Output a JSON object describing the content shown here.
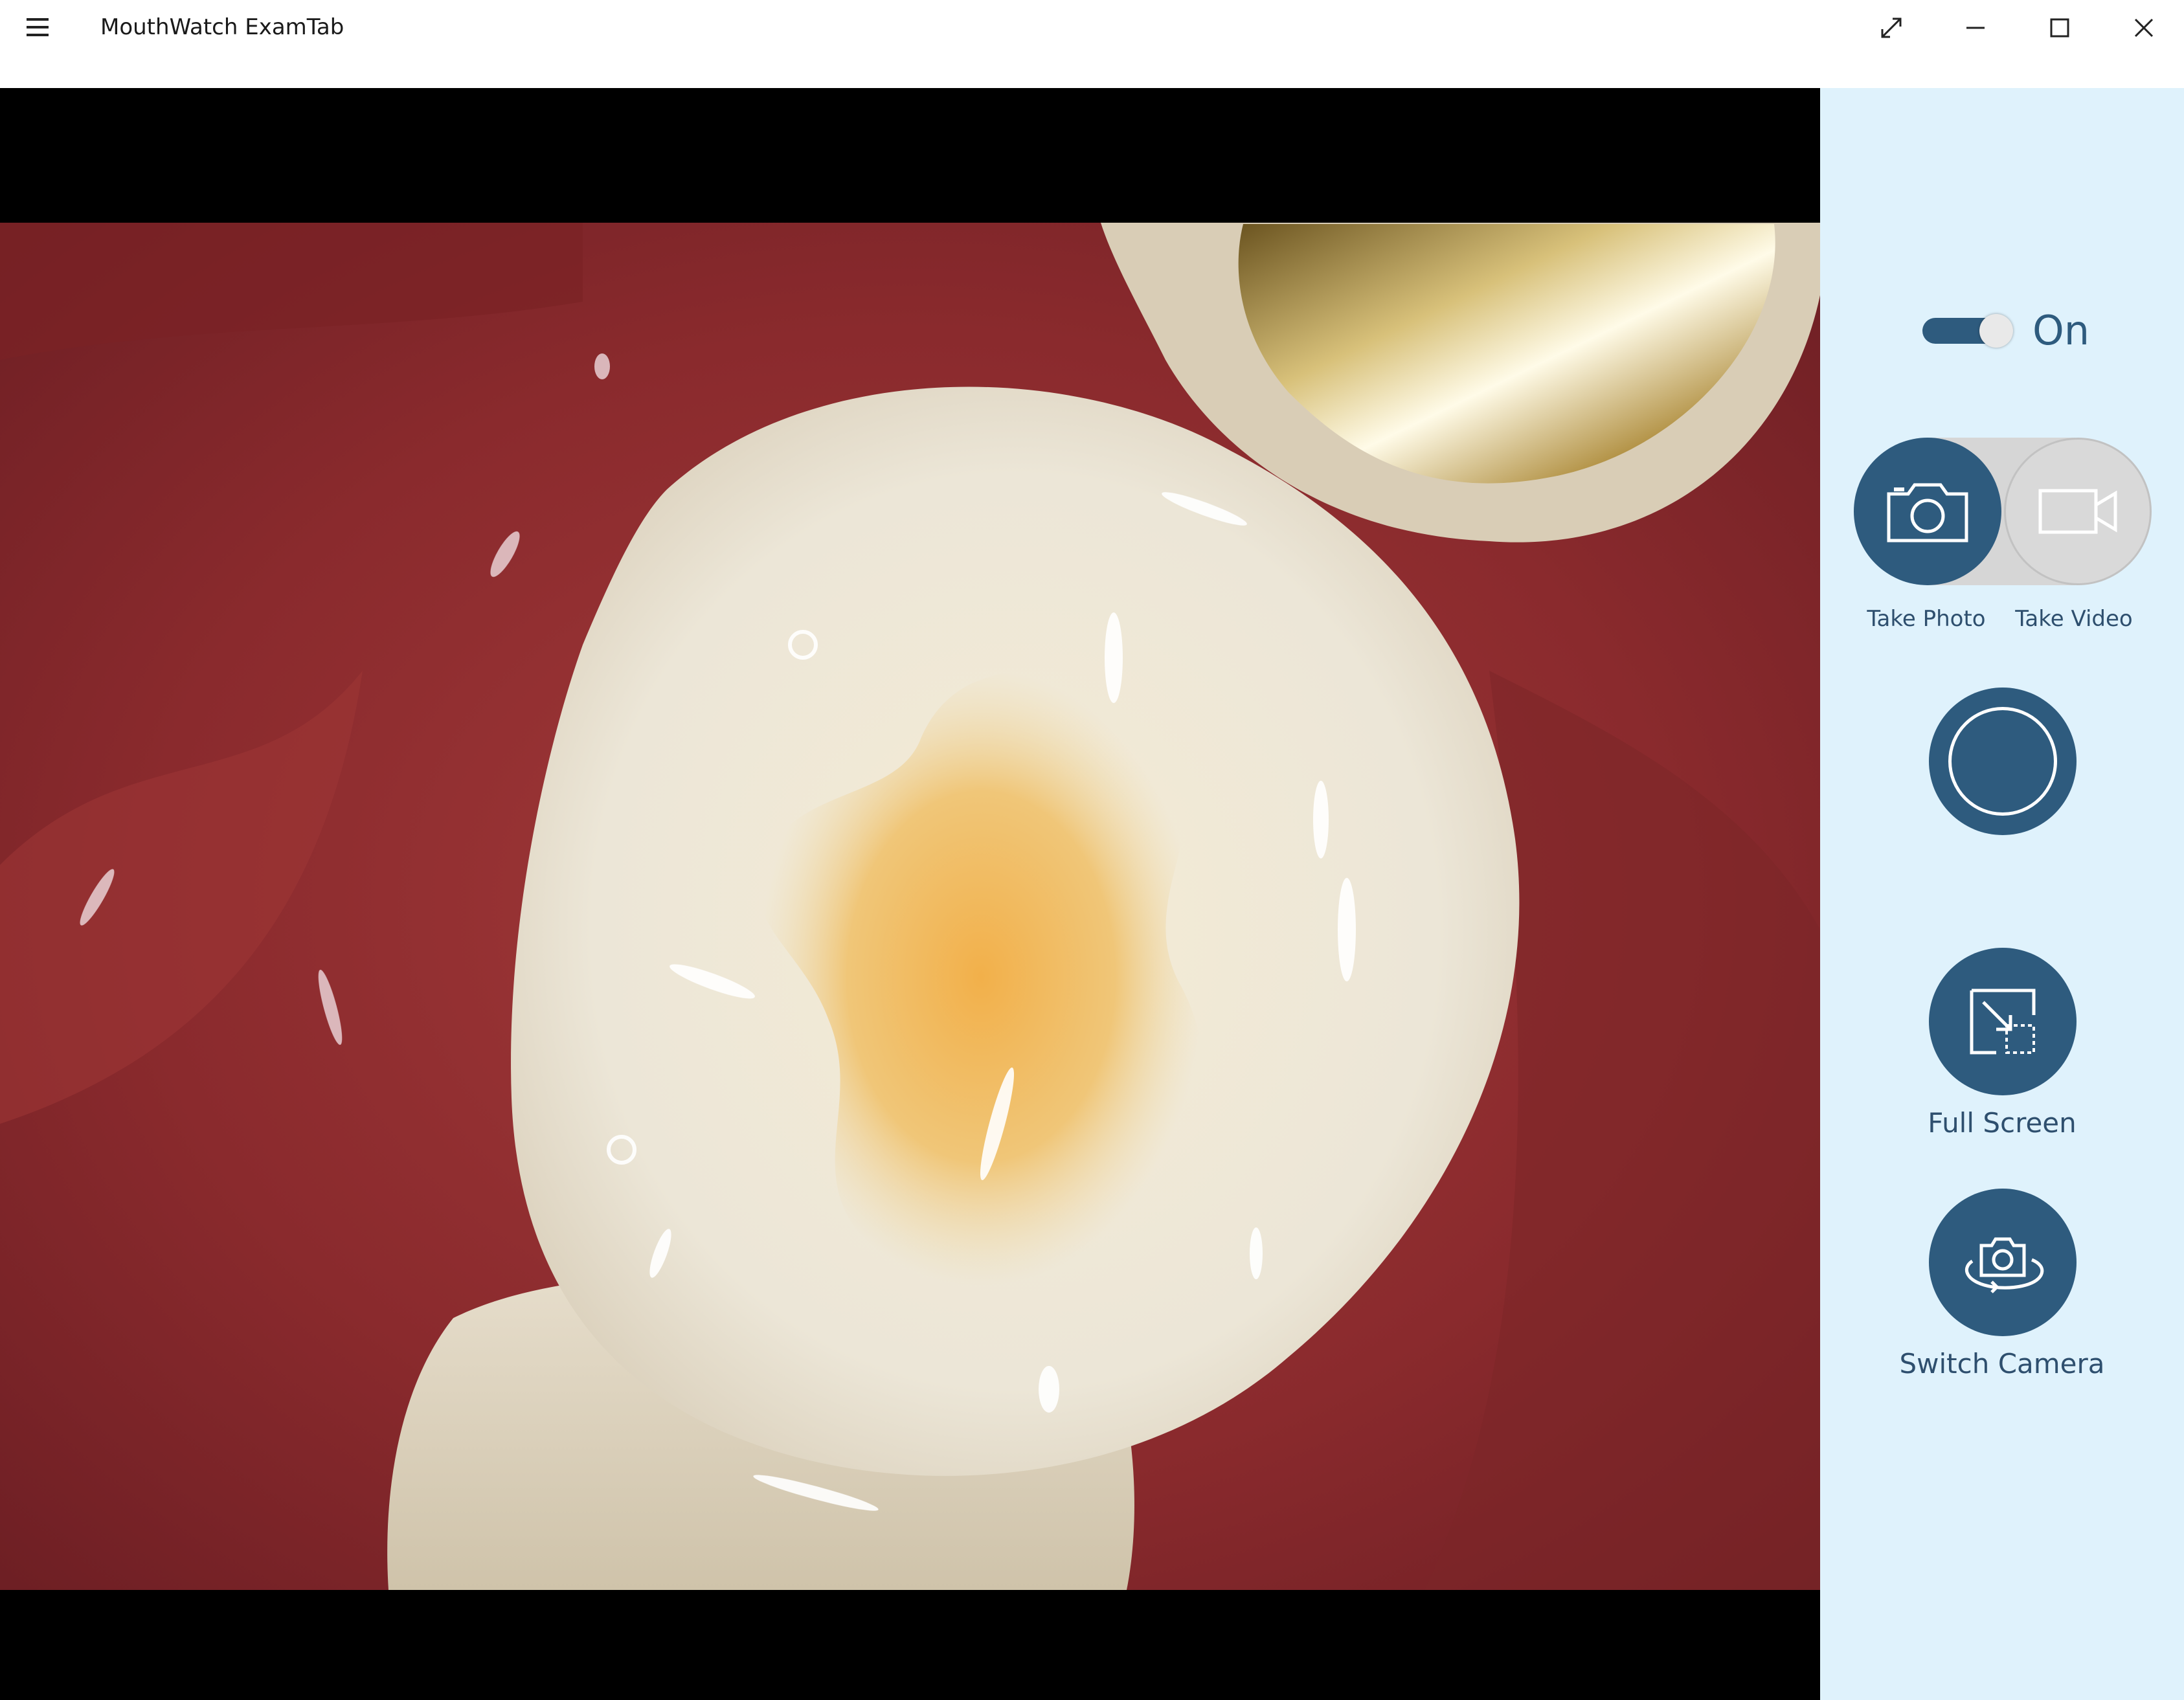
{
  "window": {
    "title": "MouthWatch ExamTab",
    "controls": [
      "expand-icon",
      "minimize-icon",
      "maximize-icon",
      "close-icon"
    ]
  },
  "camera": {
    "state_label": "On",
    "is_on": true
  },
  "capture_mode": {
    "selected": "photo",
    "photo_label": "Take Photo",
    "video_label": "Take Video"
  },
  "actions": {
    "capture_icon": "shutter-ring-icon",
    "fullscreen_label": "Full Screen",
    "fullscreen_icon": "fullscreen-icon",
    "switch_camera_label": "Switch Camera",
    "switch_camera_icon": "switch-camera-icon"
  },
  "colors": {
    "accent": "#2e5b7e",
    "panel_bg": "#dff2fc",
    "inactive": "#d9d9d9"
  }
}
